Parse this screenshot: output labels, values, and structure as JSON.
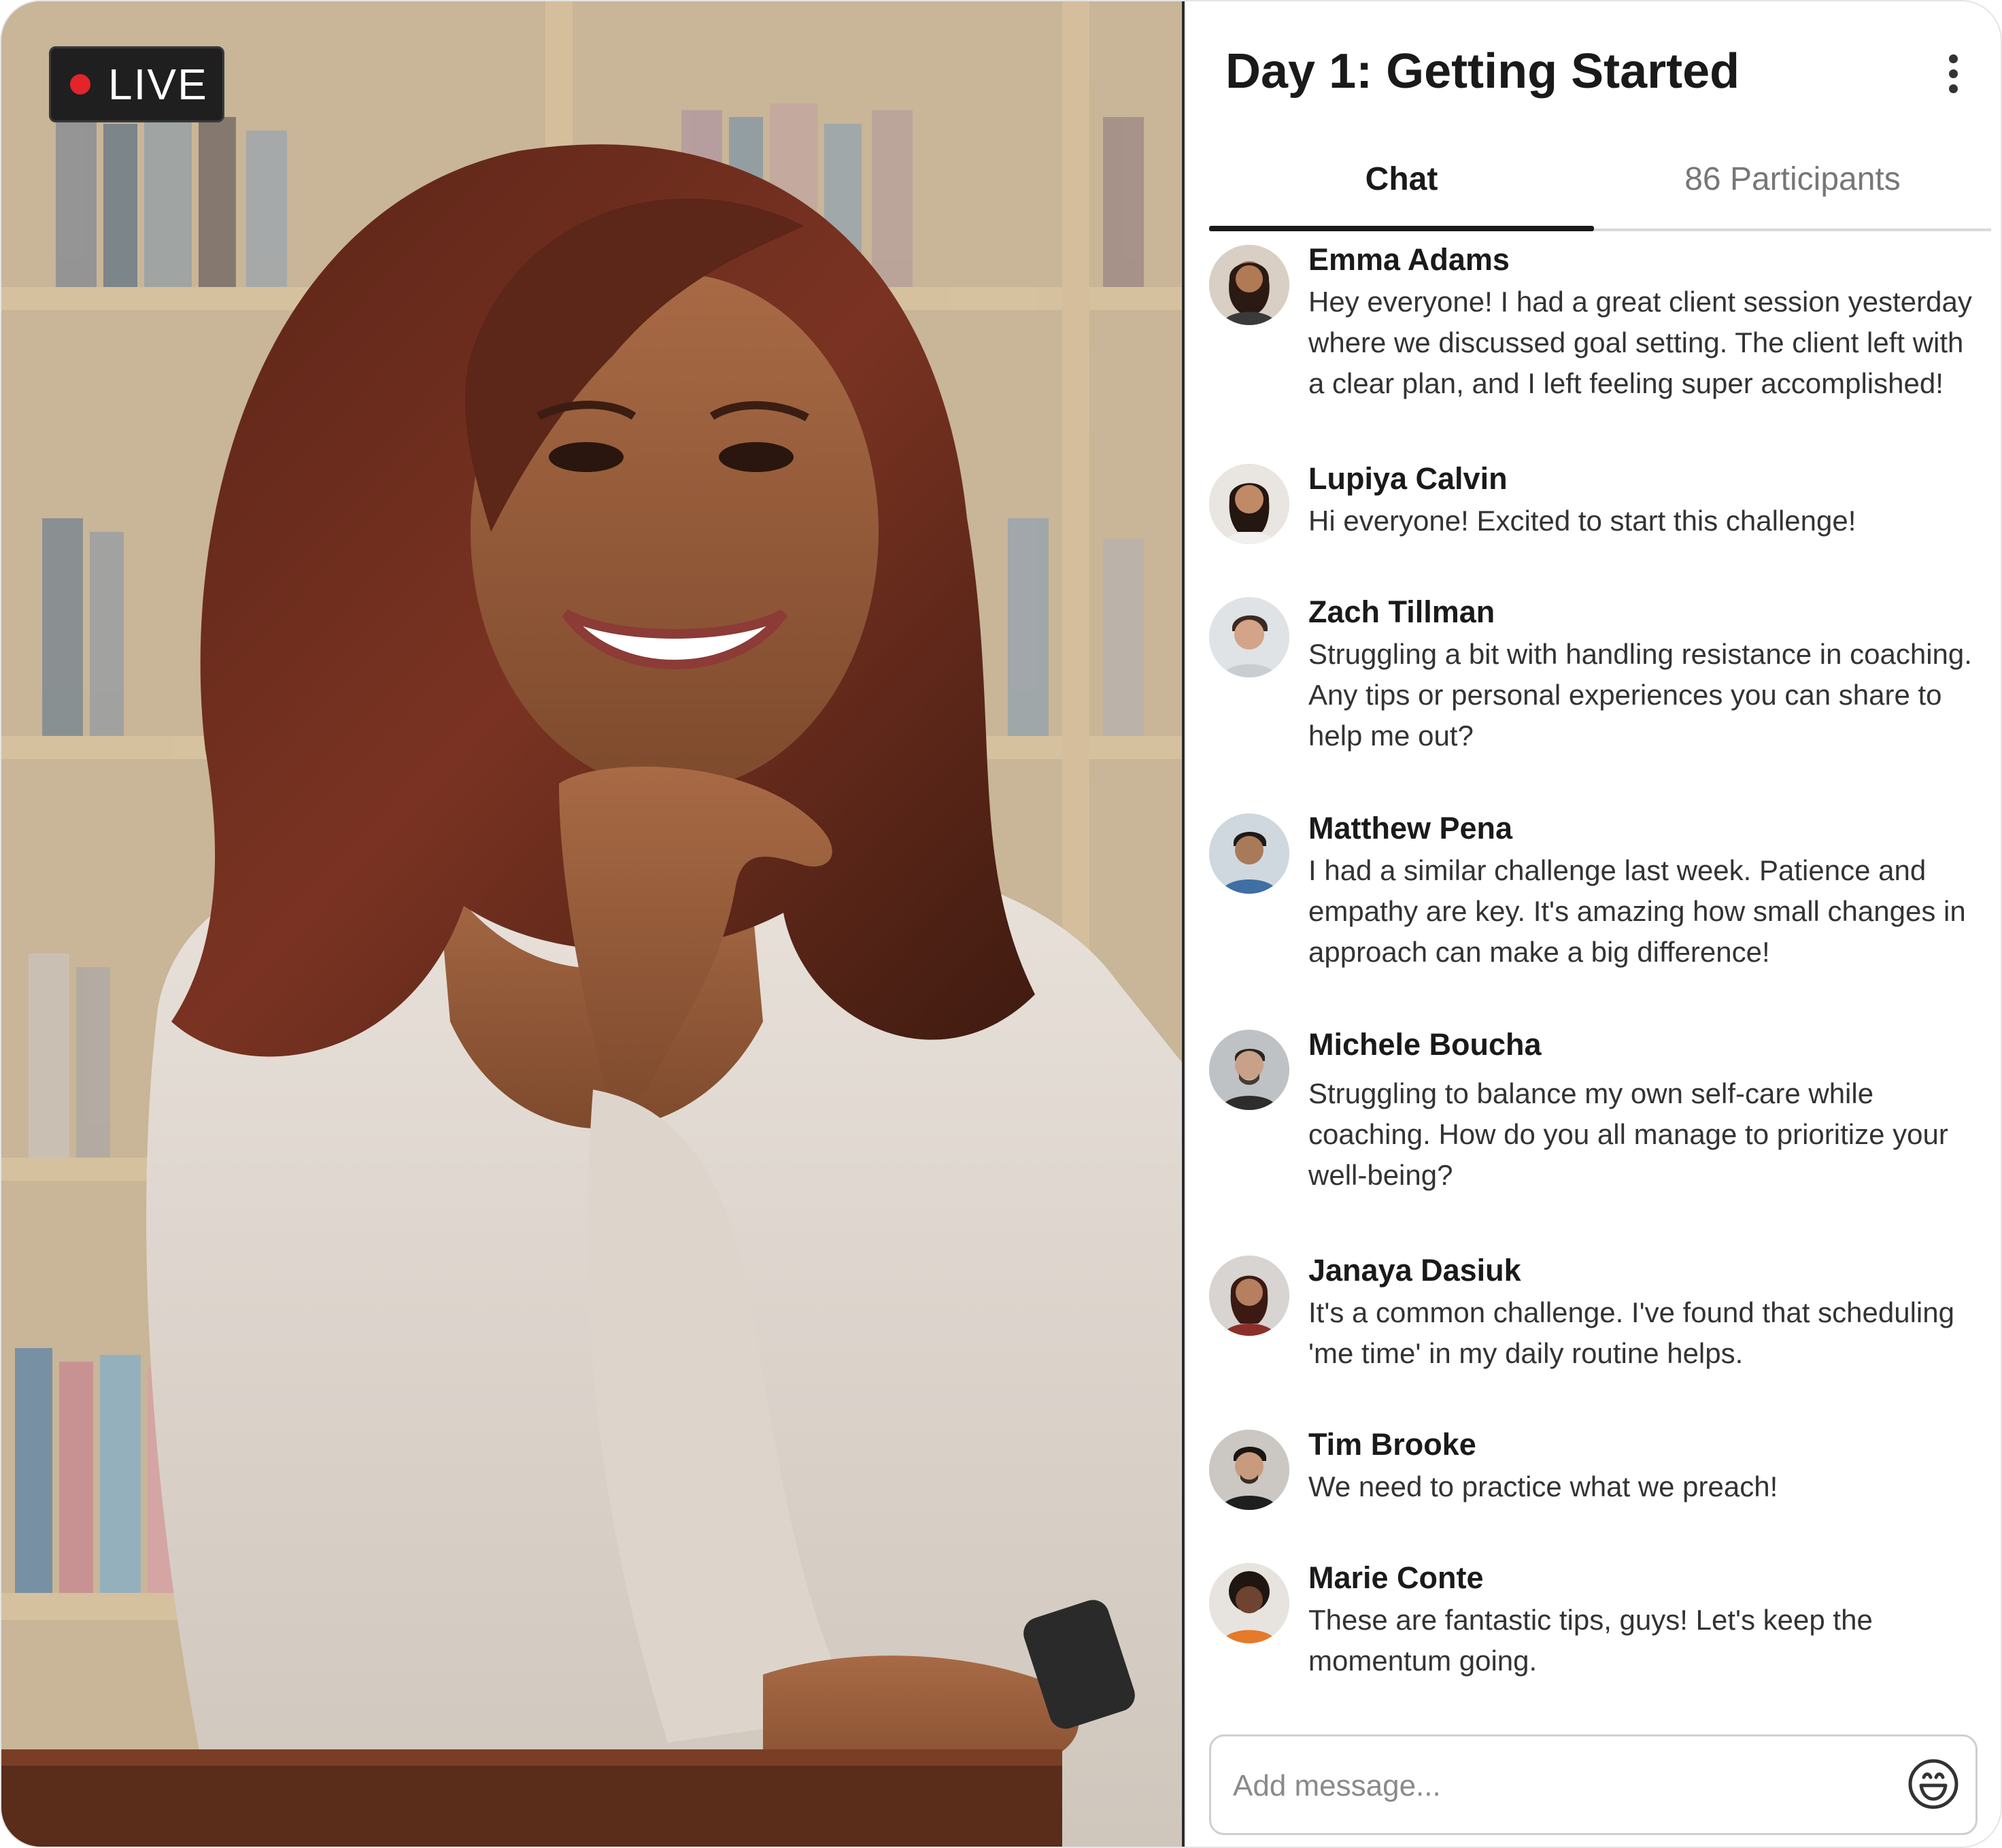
{
  "stream": {
    "live_label": "LIVE",
    "live_color": "#e3242b"
  },
  "panel": {
    "title": "Day 1: Getting Started",
    "menu_icon": "more-vertical-icon",
    "tabs": [
      {
        "label": "Chat",
        "active": true
      },
      {
        "label": "86 Participants",
        "active": false
      }
    ]
  },
  "messages": [
    {
      "name": "Emma Adams",
      "text": "Hey everyone! I had a great client session yesterday where we discussed goal setting. The client left with a clear plan, and I left feeling super accomplished!"
    },
    {
      "name": "Lupiya Calvin",
      "text": "Hi everyone! Excited to start this challenge!"
    },
    {
      "name": "Zach Tillman",
      "text": "Struggling a bit with handling resistance in coaching. Any tips or personal experiences you can share to help me out?"
    },
    {
      "name": "Matthew Pena",
      "text": "I had a similar challenge last week. Patience and empathy are key. It's amazing how small changes in approach can make a big difference!"
    },
    {
      "name": "Michele Boucha",
      "text": "Struggling to balance my own self-care while coaching. How do you all manage to prioritize your well-being?"
    },
    {
      "name": "Janaya Dasiuk",
      "text": "It's a common challenge. I've found that scheduling 'me time' in my daily routine helps."
    },
    {
      "name": "Tim Brooke",
      "text": "We need to practice what we preach!"
    },
    {
      "name": "Marie Conte",
      "text": "These are fantastic tips, guys! Let's keep the momentum going."
    }
  ],
  "composer": {
    "placeholder": "Add message...",
    "emoji_icon": "smiley-emoji-icon"
  }
}
